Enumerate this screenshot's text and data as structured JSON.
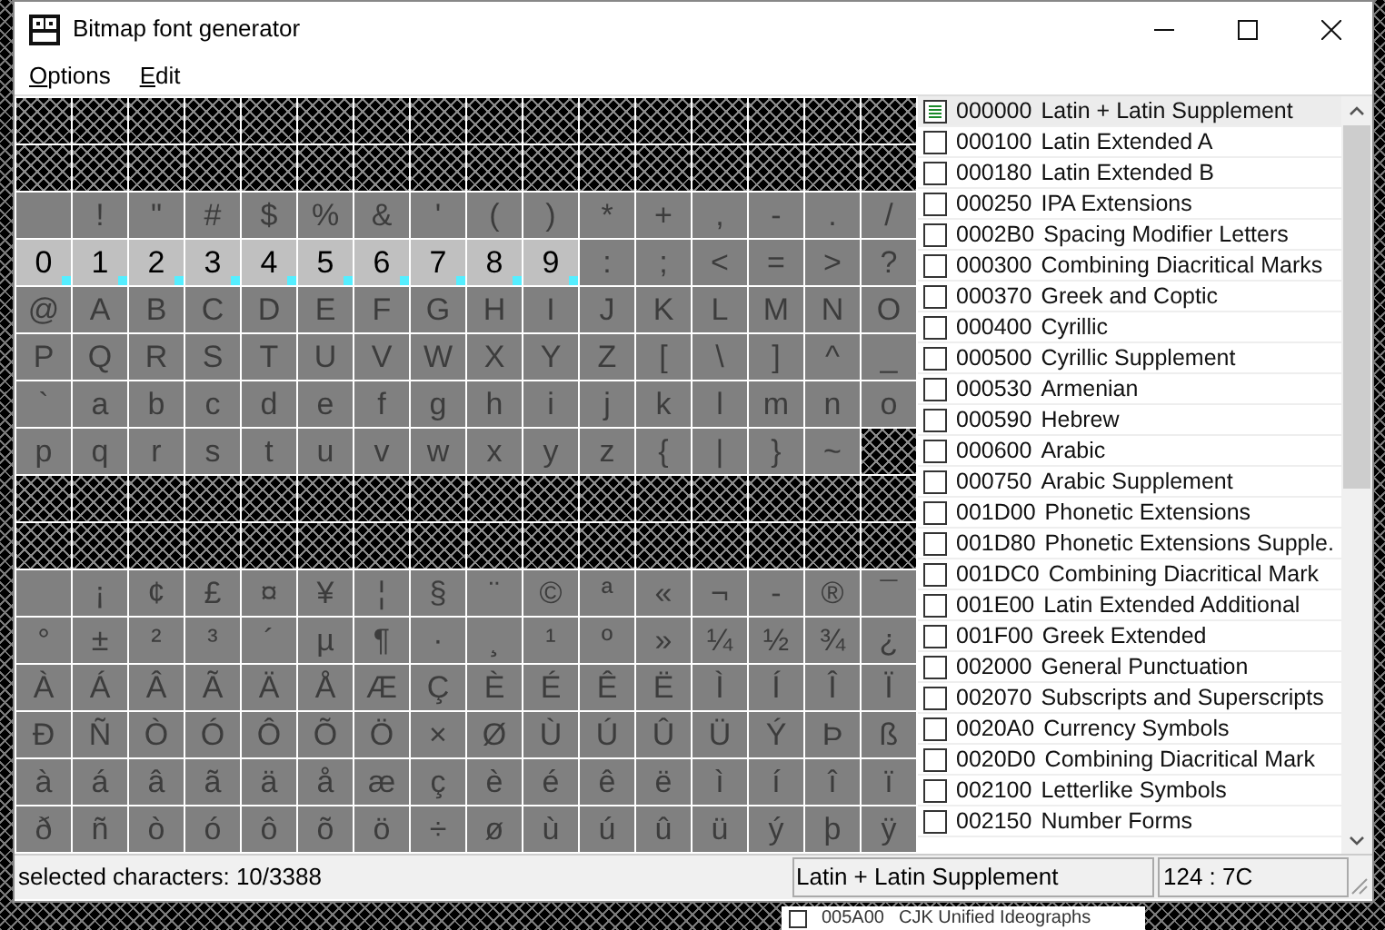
{
  "window": {
    "title": "Bitmap font generator"
  },
  "menu": [
    {
      "label": "Options"
    },
    {
      "label": "Edit"
    }
  ],
  "grid_rows": [
    {
      "kind": "unmapped"
    },
    {
      "kind": "unmapped"
    },
    {
      "kind": "chars",
      "cells": [
        {
          "kind": "blank",
          "selected": false
        },
        {
          "kind": "glyph",
          "char": "!",
          "selected": false
        },
        {
          "kind": "glyph",
          "char": "\"",
          "selected": false
        },
        {
          "kind": "glyph",
          "char": "#",
          "selected": false
        },
        {
          "kind": "glyph",
          "char": "$",
          "selected": false
        },
        {
          "kind": "glyph",
          "char": "%",
          "selected": false
        },
        {
          "kind": "glyph",
          "char": "&",
          "selected": false
        },
        {
          "kind": "glyph",
          "char": "'",
          "selected": false
        },
        {
          "kind": "glyph",
          "char": "(",
          "selected": false
        },
        {
          "kind": "glyph",
          "char": ")",
          "selected": false
        },
        {
          "kind": "glyph",
          "char": "*",
          "selected": false
        },
        {
          "kind": "glyph",
          "char": "+",
          "selected": false
        },
        {
          "kind": "glyph",
          "char": ",",
          "selected": false
        },
        {
          "kind": "glyph",
          "char": "-",
          "selected": false
        },
        {
          "kind": "glyph",
          "char": ".",
          "selected": false
        },
        {
          "kind": "glyph",
          "char": "/",
          "selected": false
        }
      ]
    },
    {
      "kind": "chars",
      "cells": [
        {
          "kind": "glyph",
          "char": "0",
          "selected": true
        },
        {
          "kind": "glyph",
          "char": "1",
          "selected": true
        },
        {
          "kind": "glyph",
          "char": "2",
          "selected": true
        },
        {
          "kind": "glyph",
          "char": "3",
          "selected": true
        },
        {
          "kind": "glyph",
          "char": "4",
          "selected": true
        },
        {
          "kind": "glyph",
          "char": "5",
          "selected": true
        },
        {
          "kind": "glyph",
          "char": "6",
          "selected": true
        },
        {
          "kind": "glyph",
          "char": "7",
          "selected": true
        },
        {
          "kind": "glyph",
          "char": "8",
          "selected": true
        },
        {
          "kind": "glyph",
          "char": "9",
          "selected": true
        },
        {
          "kind": "glyph",
          "char": ":",
          "selected": false
        },
        {
          "kind": "glyph",
          "char": ";",
          "selected": false
        },
        {
          "kind": "glyph",
          "char": "<",
          "selected": false
        },
        {
          "kind": "glyph",
          "char": "=",
          "selected": false
        },
        {
          "kind": "glyph",
          "char": ">",
          "selected": false
        },
        {
          "kind": "glyph",
          "char": "?",
          "selected": false
        }
      ]
    },
    {
      "kind": "chars",
      "cells": [
        {
          "kind": "glyph",
          "char": "@",
          "selected": false
        },
        {
          "kind": "glyph",
          "char": "A",
          "selected": false
        },
        {
          "kind": "glyph",
          "char": "B",
          "selected": false
        },
        {
          "kind": "glyph",
          "char": "C",
          "selected": false
        },
        {
          "kind": "glyph",
          "char": "D",
          "selected": false
        },
        {
          "kind": "glyph",
          "char": "E",
          "selected": false
        },
        {
          "kind": "glyph",
          "char": "F",
          "selected": false
        },
        {
          "kind": "glyph",
          "char": "G",
          "selected": false
        },
        {
          "kind": "glyph",
          "char": "H",
          "selected": false
        },
        {
          "kind": "glyph",
          "char": "I",
          "selected": false
        },
        {
          "kind": "glyph",
          "char": "J",
          "selected": false
        },
        {
          "kind": "glyph",
          "char": "K",
          "selected": false
        },
        {
          "kind": "glyph",
          "char": "L",
          "selected": false
        },
        {
          "kind": "glyph",
          "char": "M",
          "selected": false
        },
        {
          "kind": "glyph",
          "char": "N",
          "selected": false
        },
        {
          "kind": "glyph",
          "char": "O",
          "selected": false
        }
      ]
    },
    {
      "kind": "chars",
      "cells": [
        {
          "kind": "glyph",
          "char": "P",
          "selected": false
        },
        {
          "kind": "glyph",
          "char": "Q",
          "selected": false
        },
        {
          "kind": "glyph",
          "char": "R",
          "selected": false
        },
        {
          "kind": "glyph",
          "char": "S",
          "selected": false
        },
        {
          "kind": "glyph",
          "char": "T",
          "selected": false
        },
        {
          "kind": "glyph",
          "char": "U",
          "selected": false
        },
        {
          "kind": "glyph",
          "char": "V",
          "selected": false
        },
        {
          "kind": "glyph",
          "char": "W",
          "selected": false
        },
        {
          "kind": "glyph",
          "char": "X",
          "selected": false
        },
        {
          "kind": "glyph",
          "char": "Y",
          "selected": false
        },
        {
          "kind": "glyph",
          "char": "Z",
          "selected": false
        },
        {
          "kind": "glyph",
          "char": "[",
          "selected": false
        },
        {
          "kind": "glyph",
          "char": "\\",
          "selected": false
        },
        {
          "kind": "glyph",
          "char": "]",
          "selected": false
        },
        {
          "kind": "glyph",
          "char": "^",
          "selected": false
        },
        {
          "kind": "glyph",
          "char": "_",
          "selected": false
        }
      ]
    },
    {
      "kind": "chars",
      "cells": [
        {
          "kind": "glyph",
          "char": "`",
          "selected": false
        },
        {
          "kind": "glyph",
          "char": "a",
          "selected": false
        },
        {
          "kind": "glyph",
          "char": "b",
          "selected": false
        },
        {
          "kind": "glyph",
          "char": "c",
          "selected": false
        },
        {
          "kind": "glyph",
          "char": "d",
          "selected": false
        },
        {
          "kind": "glyph",
          "char": "e",
          "selected": false
        },
        {
          "kind": "glyph",
          "char": "f",
          "selected": false
        },
        {
          "kind": "glyph",
          "char": "g",
          "selected": false
        },
        {
          "kind": "glyph",
          "char": "h",
          "selected": false
        },
        {
          "kind": "glyph",
          "char": "i",
          "selected": false
        },
        {
          "kind": "glyph",
          "char": "j",
          "selected": false
        },
        {
          "kind": "glyph",
          "char": "k",
          "selected": false
        },
        {
          "kind": "glyph",
          "char": "l",
          "selected": false
        },
        {
          "kind": "glyph",
          "char": "m",
          "selected": false
        },
        {
          "kind": "glyph",
          "char": "n",
          "selected": false
        },
        {
          "kind": "glyph",
          "char": "o",
          "selected": false
        }
      ]
    },
    {
      "kind": "chars",
      "cells": [
        {
          "kind": "glyph",
          "char": "p",
          "selected": false
        },
        {
          "kind": "glyph",
          "char": "q",
          "selected": false
        },
        {
          "kind": "glyph",
          "char": "r",
          "selected": false
        },
        {
          "kind": "glyph",
          "char": "s",
          "selected": false
        },
        {
          "kind": "glyph",
          "char": "t",
          "selected": false
        },
        {
          "kind": "glyph",
          "char": "u",
          "selected": false
        },
        {
          "kind": "glyph",
          "char": "v",
          "selected": false
        },
        {
          "kind": "glyph",
          "char": "w",
          "selected": false
        },
        {
          "kind": "glyph",
          "char": "x",
          "selected": false
        },
        {
          "kind": "glyph",
          "char": "y",
          "selected": false
        },
        {
          "kind": "glyph",
          "char": "z",
          "selected": false
        },
        {
          "kind": "glyph",
          "char": "{",
          "selected": false
        },
        {
          "kind": "glyph",
          "char": "|",
          "selected": false
        },
        {
          "kind": "glyph",
          "char": "}",
          "selected": false
        },
        {
          "kind": "glyph",
          "char": "~",
          "selected": false
        },
        {
          "kind": "unmapped"
        }
      ]
    },
    {
      "kind": "unmapped"
    },
    {
      "kind": "unmapped"
    },
    {
      "kind": "chars",
      "cells": [
        {
          "kind": "blank",
          "selected": false
        },
        {
          "kind": "glyph",
          "char": "¡",
          "selected": false
        },
        {
          "kind": "glyph",
          "char": "¢",
          "selected": false
        },
        {
          "kind": "glyph",
          "char": "£",
          "selected": false
        },
        {
          "kind": "glyph",
          "char": "¤",
          "selected": false
        },
        {
          "kind": "glyph",
          "char": "¥",
          "selected": false
        },
        {
          "kind": "glyph",
          "char": "¦",
          "selected": false
        },
        {
          "kind": "glyph",
          "char": "§",
          "selected": false
        },
        {
          "kind": "glyph",
          "char": "¨",
          "selected": false
        },
        {
          "kind": "glyph",
          "char": "©",
          "selected": false
        },
        {
          "kind": "glyph",
          "char": "ª",
          "selected": false
        },
        {
          "kind": "glyph",
          "char": "«",
          "selected": false
        },
        {
          "kind": "glyph",
          "char": "¬",
          "selected": false
        },
        {
          "kind": "glyph",
          "char": "-",
          "selected": false
        },
        {
          "kind": "glyph",
          "char": "®",
          "selected": false
        },
        {
          "kind": "glyph",
          "char": "¯",
          "selected": false
        }
      ]
    },
    {
      "kind": "chars",
      "cells": [
        {
          "kind": "glyph",
          "char": "°",
          "selected": false
        },
        {
          "kind": "glyph",
          "char": "±",
          "selected": false
        },
        {
          "kind": "glyph",
          "char": "²",
          "selected": false
        },
        {
          "kind": "glyph",
          "char": "³",
          "selected": false
        },
        {
          "kind": "glyph",
          "char": "´",
          "selected": false
        },
        {
          "kind": "glyph",
          "char": "µ",
          "selected": false
        },
        {
          "kind": "glyph",
          "char": "¶",
          "selected": false
        },
        {
          "kind": "glyph",
          "char": "·",
          "selected": false
        },
        {
          "kind": "glyph",
          "char": "¸",
          "selected": false
        },
        {
          "kind": "glyph",
          "char": "¹",
          "selected": false
        },
        {
          "kind": "glyph",
          "char": "º",
          "selected": false
        },
        {
          "kind": "glyph",
          "char": "»",
          "selected": false
        },
        {
          "kind": "glyph",
          "char": "¼",
          "selected": false
        },
        {
          "kind": "glyph",
          "char": "½",
          "selected": false
        },
        {
          "kind": "glyph",
          "char": "¾",
          "selected": false
        },
        {
          "kind": "glyph",
          "char": "¿",
          "selected": false
        }
      ]
    },
    {
      "kind": "chars",
      "cells": [
        {
          "kind": "glyph",
          "char": "À",
          "selected": false
        },
        {
          "kind": "glyph",
          "char": "Á",
          "selected": false
        },
        {
          "kind": "glyph",
          "char": "Â",
          "selected": false
        },
        {
          "kind": "glyph",
          "char": "Ã",
          "selected": false
        },
        {
          "kind": "glyph",
          "char": "Ä",
          "selected": false
        },
        {
          "kind": "glyph",
          "char": "Å",
          "selected": false
        },
        {
          "kind": "glyph",
          "char": "Æ",
          "selected": false
        },
        {
          "kind": "glyph",
          "char": "Ç",
          "selected": false
        },
        {
          "kind": "glyph",
          "char": "È",
          "selected": false
        },
        {
          "kind": "glyph",
          "char": "É",
          "selected": false
        },
        {
          "kind": "glyph",
          "char": "Ê",
          "selected": false
        },
        {
          "kind": "glyph",
          "char": "Ë",
          "selected": false
        },
        {
          "kind": "glyph",
          "char": "Ì",
          "selected": false
        },
        {
          "kind": "glyph",
          "char": "Í",
          "selected": false
        },
        {
          "kind": "glyph",
          "char": "Î",
          "selected": false
        },
        {
          "kind": "glyph",
          "char": "Ï",
          "selected": false
        }
      ]
    },
    {
      "kind": "chars",
      "cells": [
        {
          "kind": "glyph",
          "char": "Ð",
          "selected": false
        },
        {
          "kind": "glyph",
          "char": "Ñ",
          "selected": false
        },
        {
          "kind": "glyph",
          "char": "Ò",
          "selected": false
        },
        {
          "kind": "glyph",
          "char": "Ó",
          "selected": false
        },
        {
          "kind": "glyph",
          "char": "Ô",
          "selected": false
        },
        {
          "kind": "glyph",
          "char": "Õ",
          "selected": false
        },
        {
          "kind": "glyph",
          "char": "Ö",
          "selected": false
        },
        {
          "kind": "glyph",
          "char": "×",
          "selected": false
        },
        {
          "kind": "glyph",
          "char": "Ø",
          "selected": false
        },
        {
          "kind": "glyph",
          "char": "Ù",
          "selected": false
        },
        {
          "kind": "glyph",
          "char": "Ú",
          "selected": false
        },
        {
          "kind": "glyph",
          "char": "Û",
          "selected": false
        },
        {
          "kind": "glyph",
          "char": "Ü",
          "selected": false
        },
        {
          "kind": "glyph",
          "char": "Ý",
          "selected": false
        },
        {
          "kind": "glyph",
          "char": "Þ",
          "selected": false
        },
        {
          "kind": "glyph",
          "char": "ß",
          "selected": false
        }
      ]
    },
    {
      "kind": "chars",
      "cells": [
        {
          "kind": "glyph",
          "char": "à",
          "selected": false
        },
        {
          "kind": "glyph",
          "char": "á",
          "selected": false
        },
        {
          "kind": "glyph",
          "char": "â",
          "selected": false
        },
        {
          "kind": "glyph",
          "char": "ã",
          "selected": false
        },
        {
          "kind": "glyph",
          "char": "ä",
          "selected": false
        },
        {
          "kind": "glyph",
          "char": "å",
          "selected": false
        },
        {
          "kind": "glyph",
          "char": "æ",
          "selected": false
        },
        {
          "kind": "glyph",
          "char": "ç",
          "selected": false
        },
        {
          "kind": "glyph",
          "char": "è",
          "selected": false
        },
        {
          "kind": "glyph",
          "char": "é",
          "selected": false
        },
        {
          "kind": "glyph",
          "char": "ê",
          "selected": false
        },
        {
          "kind": "glyph",
          "char": "ë",
          "selected": false
        },
        {
          "kind": "glyph",
          "char": "ì",
          "selected": false
        },
        {
          "kind": "glyph",
          "char": "í",
          "selected": false
        },
        {
          "kind": "glyph",
          "char": "î",
          "selected": false
        },
        {
          "kind": "glyph",
          "char": "ï",
          "selected": false
        }
      ]
    },
    {
      "kind": "chars",
      "cells": [
        {
          "kind": "glyph",
          "char": "ð",
          "selected": false
        },
        {
          "kind": "glyph",
          "char": "ñ",
          "selected": false
        },
        {
          "kind": "glyph",
          "char": "ò",
          "selected": false
        },
        {
          "kind": "glyph",
          "char": "ó",
          "selected": false
        },
        {
          "kind": "glyph",
          "char": "ô",
          "selected": false
        },
        {
          "kind": "glyph",
          "char": "õ",
          "selected": false
        },
        {
          "kind": "glyph",
          "char": "ö",
          "selected": false
        },
        {
          "kind": "glyph",
          "char": "÷",
          "selected": false
        },
        {
          "kind": "glyph",
          "char": "ø",
          "selected": false
        },
        {
          "kind": "glyph",
          "char": "ù",
          "selected": false
        },
        {
          "kind": "glyph",
          "char": "ú",
          "selected": false
        },
        {
          "kind": "glyph",
          "char": "û",
          "selected": false
        },
        {
          "kind": "glyph",
          "char": "ü",
          "selected": false
        },
        {
          "kind": "glyph",
          "char": "ý",
          "selected": false
        },
        {
          "kind": "glyph",
          "char": "þ",
          "selected": false
        },
        {
          "kind": "glyph",
          "char": "ÿ",
          "selected": false
        }
      ]
    }
  ],
  "subsets": [
    {
      "code": "000000",
      "name": "Latin + Latin Supplement",
      "checked": true,
      "selected": true
    },
    {
      "code": "000100",
      "name": "Latin Extended A",
      "checked": false,
      "selected": false
    },
    {
      "code": "000180",
      "name": "Latin Extended B",
      "checked": false,
      "selected": false
    },
    {
      "code": "000250",
      "name": "IPA Extensions",
      "checked": false,
      "selected": false
    },
    {
      "code": "0002B0",
      "name": "Spacing Modifier Letters",
      "checked": false,
      "selected": false
    },
    {
      "code": "000300",
      "name": "Combining Diacritical Marks",
      "checked": false,
      "selected": false
    },
    {
      "code": "000370",
      "name": "Greek and Coptic",
      "checked": false,
      "selected": false
    },
    {
      "code": "000400",
      "name": "Cyrillic",
      "checked": false,
      "selected": false
    },
    {
      "code": "000500",
      "name": "Cyrillic Supplement",
      "checked": false,
      "selected": false
    },
    {
      "code": "000530",
      "name": "Armenian",
      "checked": false,
      "selected": false
    },
    {
      "code": "000590",
      "name": "Hebrew",
      "checked": false,
      "selected": false
    },
    {
      "code": "000600",
      "name": "Arabic",
      "checked": false,
      "selected": false
    },
    {
      "code": "000750",
      "name": "Arabic Supplement",
      "checked": false,
      "selected": false
    },
    {
      "code": "001D00",
      "name": "Phonetic Extensions",
      "checked": false,
      "selected": false
    },
    {
      "code": "001D80",
      "name": "Phonetic Extensions Supple.",
      "checked": false,
      "selected": false
    },
    {
      "code": "001DC0",
      "name": "Combining Diacritical Mark",
      "checked": false,
      "selected": false
    },
    {
      "code": "001E00",
      "name": "Latin Extended Additional",
      "checked": false,
      "selected": false
    },
    {
      "code": "001F00",
      "name": "Greek Extended",
      "checked": false,
      "selected": false
    },
    {
      "code": "002000",
      "name": "General Punctuation",
      "checked": false,
      "selected": false
    },
    {
      "code": "002070",
      "name": "Subscripts and Superscripts",
      "checked": false,
      "selected": false
    },
    {
      "code": "0020A0",
      "name": "Currency Symbols",
      "checked": false,
      "selected": false
    },
    {
      "code": "0020D0",
      "name": "Combining Diacritical Mark",
      "checked": false,
      "selected": false
    },
    {
      "code": "002100",
      "name": "Letterlike Symbols",
      "checked": false,
      "selected": false
    },
    {
      "code": "002150",
      "name": "Number Forms",
      "checked": false,
      "selected": false
    }
  ],
  "status_bar": {
    "selection": "selected characters: 10/3388",
    "subset": "Latin + Latin Supplement",
    "char_code": "124 : 7C"
  },
  "background_window": {
    "list_item": {
      "code": "005A00",
      "name": "CJK Unified Ideographs",
      "checked": false
    }
  }
}
